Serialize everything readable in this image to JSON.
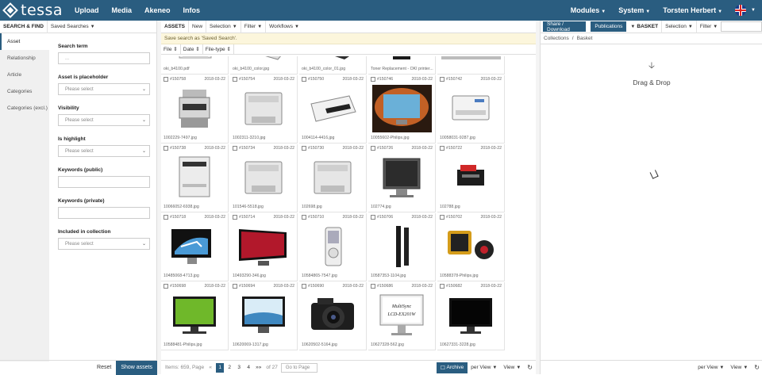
{
  "app": {
    "logo": "tessa",
    "nav": [
      "Upload",
      "Media",
      "Akeneo",
      "Infos"
    ],
    "nav_right": [
      "Modules",
      "System",
      "Torsten Herbert"
    ]
  },
  "left": {
    "title": "SEARCH & FIND",
    "saved_searches": "Saved Searches",
    "tabs": [
      "Asset",
      "Relationship",
      "Article",
      "Categories",
      "Categories (excl.)"
    ],
    "fields": {
      "search_term": {
        "label": "Search term",
        "placeholder": "..."
      },
      "placeholder": {
        "label": "Asset is placeholder",
        "value": "Please select"
      },
      "visibility": {
        "label": "Visibility",
        "value": "Please select"
      },
      "highlight": {
        "label": "Is highlight",
        "value": "Please select"
      },
      "kw_public": {
        "label": "Keywords (public)"
      },
      "kw_private": {
        "label": "Keywords (private)"
      },
      "collection": {
        "label": "Included in collection",
        "value": "Please select"
      }
    },
    "reset": "Reset",
    "show": "Show assets"
  },
  "mid": {
    "title": "ASSETS",
    "new": "New",
    "selection": "Selection",
    "filter": "Filter",
    "workflows": "Workflows",
    "notice": "Save search as 'Saved Search'.",
    "sorts": [
      "File",
      "Date",
      "File-type"
    ],
    "partial_row": [
      "oki_b4100.pdf",
      "oki_b4100_color.jpg",
      "oki_b4100_color_01.jpg",
      "Toner Replacement - OKI printer..."
    ],
    "assets": [
      {
        "id": "#150758",
        "date": "2018-03-22",
        "file": "1002229-7497.jpg",
        "thumb": "printer-mfp"
      },
      {
        "id": "#150754",
        "date": "2018-03-22",
        "file": "1002311-3210.jpg",
        "thumb": "printer-laser"
      },
      {
        "id": "#150750",
        "date": "2018-03-22",
        "file": "1004114-4416.jpg",
        "thumb": "printer-inkjet"
      },
      {
        "id": "#150746",
        "date": "2018-03-22",
        "file": "10055602-Philips.jpg",
        "thumb": "tv-ambilight"
      },
      {
        "id": "#150742",
        "date": "2018-03-22",
        "file": "10058031-9287.jpg",
        "thumb": "printer-white"
      },
      {
        "id": "#150738",
        "date": "2018-03-22",
        "file": "10066052-6938.jpg",
        "thumb": "printer-tall"
      },
      {
        "id": "#150734",
        "date": "2018-03-22",
        "file": "101546-5518.jpg",
        "thumb": "printer-laser"
      },
      {
        "id": "#150730",
        "date": "2018-03-22",
        "file": "102698.jpg",
        "thumb": "printer-laser"
      },
      {
        "id": "#150726",
        "date": "2018-03-22",
        "file": "102774.jpg",
        "thumb": "monitor-gray"
      },
      {
        "id": "#150722",
        "date": "2018-03-22",
        "file": "102788.jpg",
        "thumb": "printer-photo"
      },
      {
        "id": "#150718",
        "date": "2018-03-22",
        "file": "10485068-4713.jpg",
        "thumb": "tv-wave"
      },
      {
        "id": "#150714",
        "date": "2018-03-22",
        "file": "10493290-346.jpg",
        "thumb": "monitor-red"
      },
      {
        "id": "#150710",
        "date": "2018-03-22",
        "file": "10584865-7547.jpg",
        "thumb": "mp3-player"
      },
      {
        "id": "#150706",
        "date": "2018-03-22",
        "file": "10587353-1104.jpg",
        "thumb": "speakers"
      },
      {
        "id": "#150702",
        "date": "2018-03-22",
        "file": "10588378-Philips.jpg",
        "thumb": "speaker-set"
      },
      {
        "id": "#150698",
        "date": "2018-03-22",
        "file": "10588481-Philips.jpg",
        "thumb": "monitor-green"
      },
      {
        "id": "#150694",
        "date": "2018-03-22",
        "file": "10620069-1317.jpg",
        "thumb": "monitor-water"
      },
      {
        "id": "#150690",
        "date": "2018-03-22",
        "file": "10620502-5164.jpg",
        "thumb": "camera"
      },
      {
        "id": "#150686",
        "date": "2018-03-22",
        "file": "10627328-562.jpg",
        "thumb": "monitor-multisync"
      },
      {
        "id": "#150682",
        "date": "2018-03-22",
        "file": "10627331-3228.jpg",
        "thumb": "monitor-black"
      }
    ],
    "multisync_text": "MultiSync LCD-EX201W",
    "footer": {
      "items": "Items: 659, Page",
      "first": "«",
      "pages": [
        "1",
        "2",
        "3",
        "4"
      ],
      "next": "»»",
      "of": "of 27",
      "goto": "Go to Page",
      "archive": "Archive",
      "per_view": "per View",
      "view": "View"
    }
  },
  "right": {
    "share": "Share / Download",
    "publications": "Publications",
    "basket": "BASKET",
    "selection": "Selection",
    "filter": "Filter",
    "crumbs": [
      "Collections",
      "Basket"
    ],
    "drop": "Drag & Drop",
    "per_view": "per View",
    "view": "View"
  }
}
